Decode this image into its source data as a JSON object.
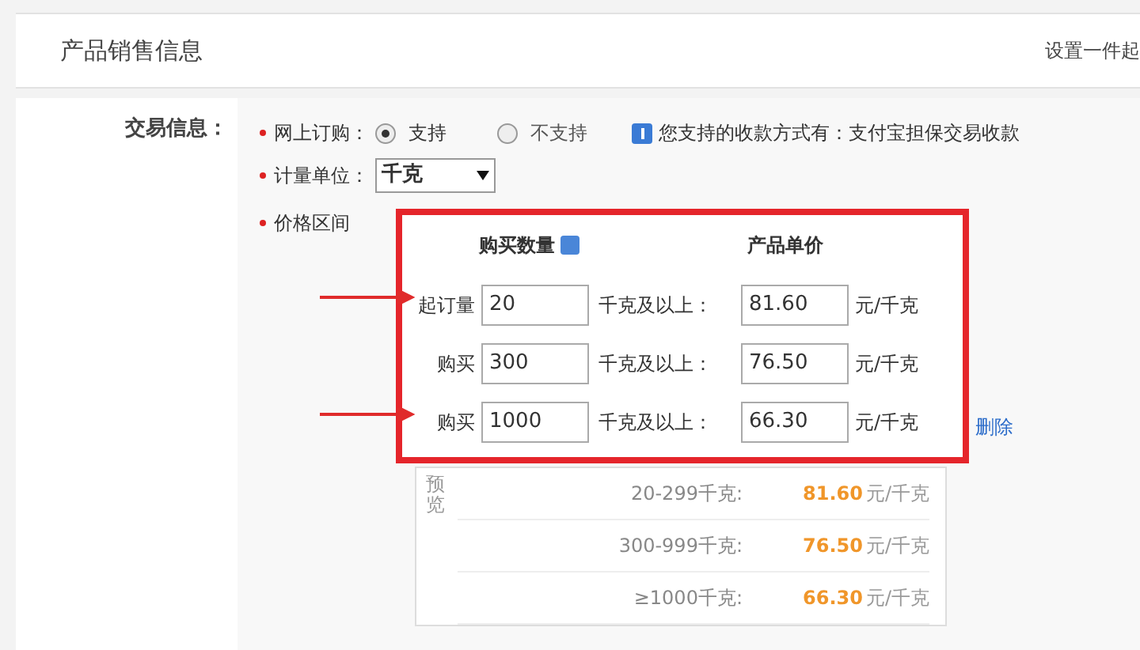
{
  "section": {
    "title": "产品销售信息",
    "hint": "设置一件起"
  },
  "trade": {
    "label": "交易信息：",
    "online_order": {
      "label": "网上订购：",
      "required": true,
      "options": [
        {
          "label": "支持",
          "selected": true
        },
        {
          "label": "不支持",
          "selected": false
        }
      ],
      "info": "您支持的收款方式有：支付宝担保交易收款"
    },
    "unit": {
      "label": "计量单位：",
      "required": true,
      "value": "千克"
    },
    "price_range": {
      "label": "价格区间",
      "required": true,
      "columns": [
        "购买数量",
        "产品单价"
      ],
      "rows": [
        {
          "label": "起订量",
          "quantity": "20",
          "quantity_suffix": "千克及以上：",
          "price": "81.60",
          "price_suffix": "元/千克",
          "highlighted": true
        },
        {
          "label": "购买",
          "quantity": "300",
          "quantity_suffix": "千克及以上：",
          "price": "76.50",
          "price_suffix": "元/千克",
          "highlighted": false
        },
        {
          "label": "购买",
          "quantity": "1000",
          "quantity_suffix": "千克及以上：",
          "price": "66.30",
          "price_suffix": "元/千克",
          "highlighted": true
        }
      ],
      "delete_link": "删除"
    },
    "preview": {
      "label": "预览",
      "rows": [
        {
          "range": "20-299千克:",
          "price": "81.60",
          "unit": "元/千克"
        },
        {
          "range": "300-999千克:",
          "price": "76.50",
          "unit": "元/千克"
        },
        {
          "range": "≥1000千克:",
          "price": "66.30",
          "unit": "元/千克"
        }
      ]
    }
  }
}
